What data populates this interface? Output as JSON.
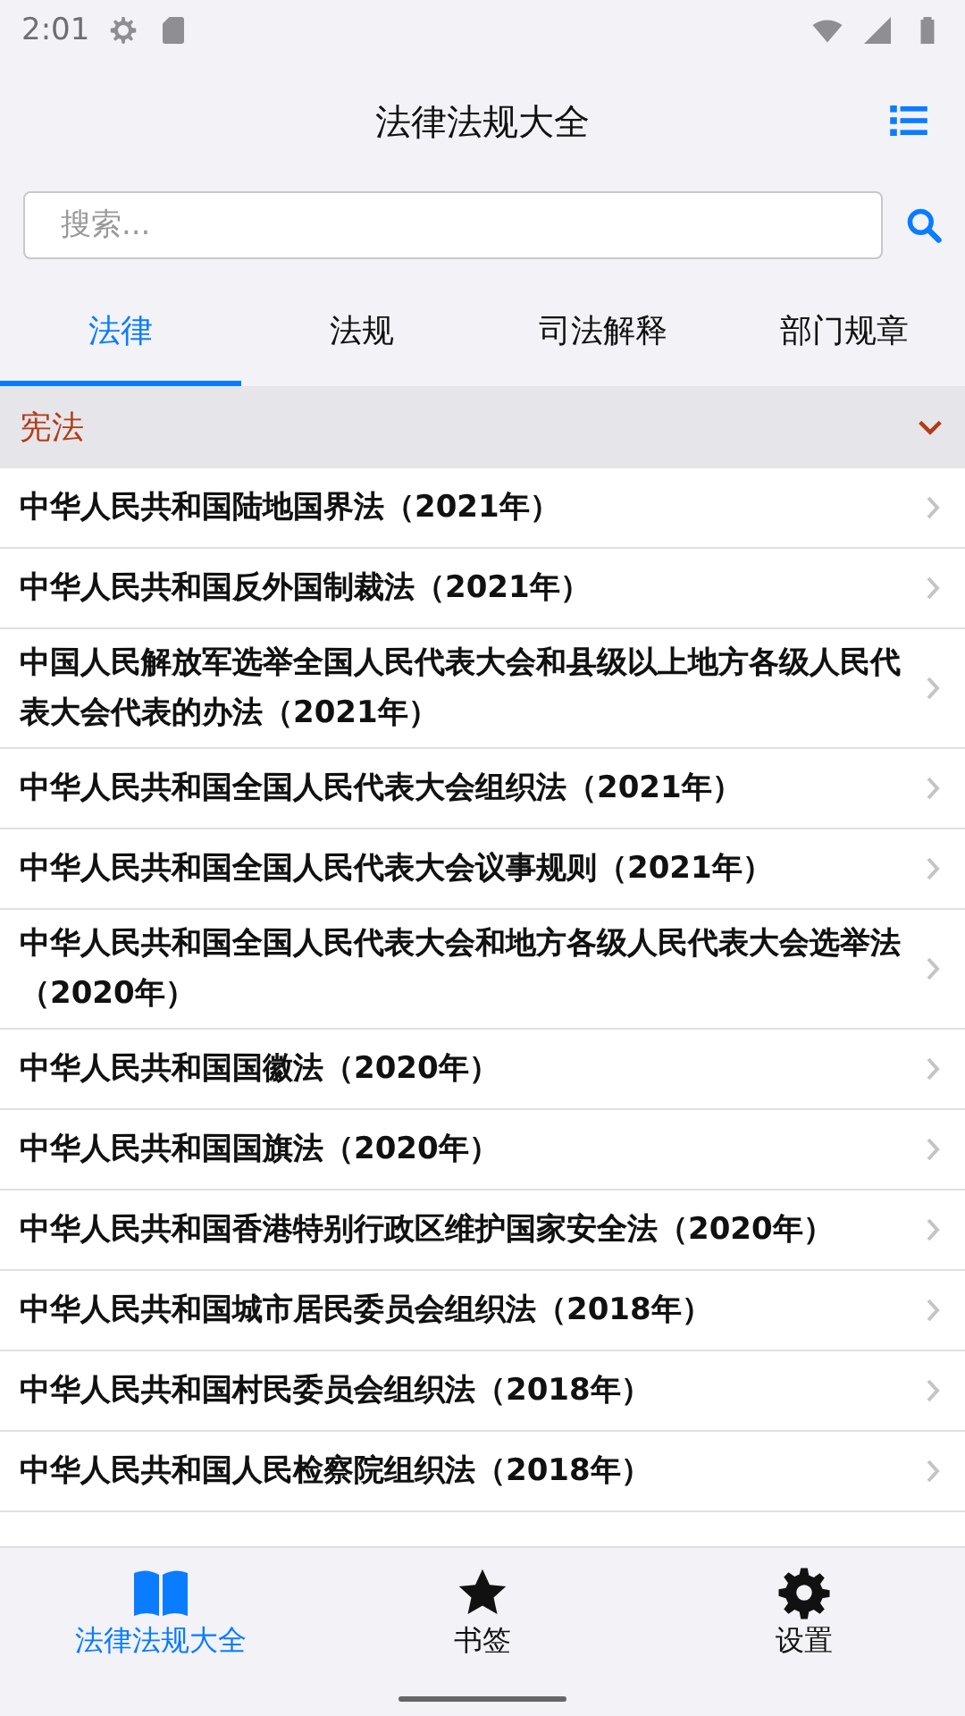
{
  "status_bar": {
    "time": "2:01"
  },
  "header": {
    "title": "法律法规大全"
  },
  "search": {
    "placeholder": "搜索..."
  },
  "tabs": [
    {
      "label": "法律",
      "selected": true
    },
    {
      "label": "法规",
      "selected": false
    },
    {
      "label": "司法解释",
      "selected": false
    },
    {
      "label": "部门规章",
      "selected": false
    }
  ],
  "section": {
    "title": "宪法",
    "expanded": true
  },
  "items": [
    {
      "title": "中华人民共和国陆地国界法（2021年）"
    },
    {
      "title": "中华人民共和国反外国制裁法（2021年）"
    },
    {
      "title": "中国人民解放军选举全国人民代表大会和县级以上地方各级人民代表大会代表的办法（2021年）"
    },
    {
      "title": "中华人民共和国全国人民代表大会组织法（2021年）"
    },
    {
      "title": "中华人民共和国全国人民代表大会议事规则（2021年）"
    },
    {
      "title": "中华人民共和国全国人民代表大会和地方各级人民代表大会选举法（2020年）"
    },
    {
      "title": "中华人民共和国国徽法（2020年）"
    },
    {
      "title": "中华人民共和国国旗法（2020年）"
    },
    {
      "title": "中华人民共和国香港特别行政区维护国家安全法（2020年）"
    },
    {
      "title": "中华人民共和国城市居民委员会组织法（2018年）"
    },
    {
      "title": "中华人民共和国村民委员会组织法（2018年）"
    },
    {
      "title": "中华人民共和国人民检察院组织法（2018年）"
    }
  ],
  "bottom_nav": [
    {
      "kind": "book",
      "label": "法律法规大全",
      "selected": true
    },
    {
      "kind": "star",
      "label": "书签",
      "selected": false
    },
    {
      "kind": "gear",
      "label": "设置",
      "selected": false
    }
  ]
}
